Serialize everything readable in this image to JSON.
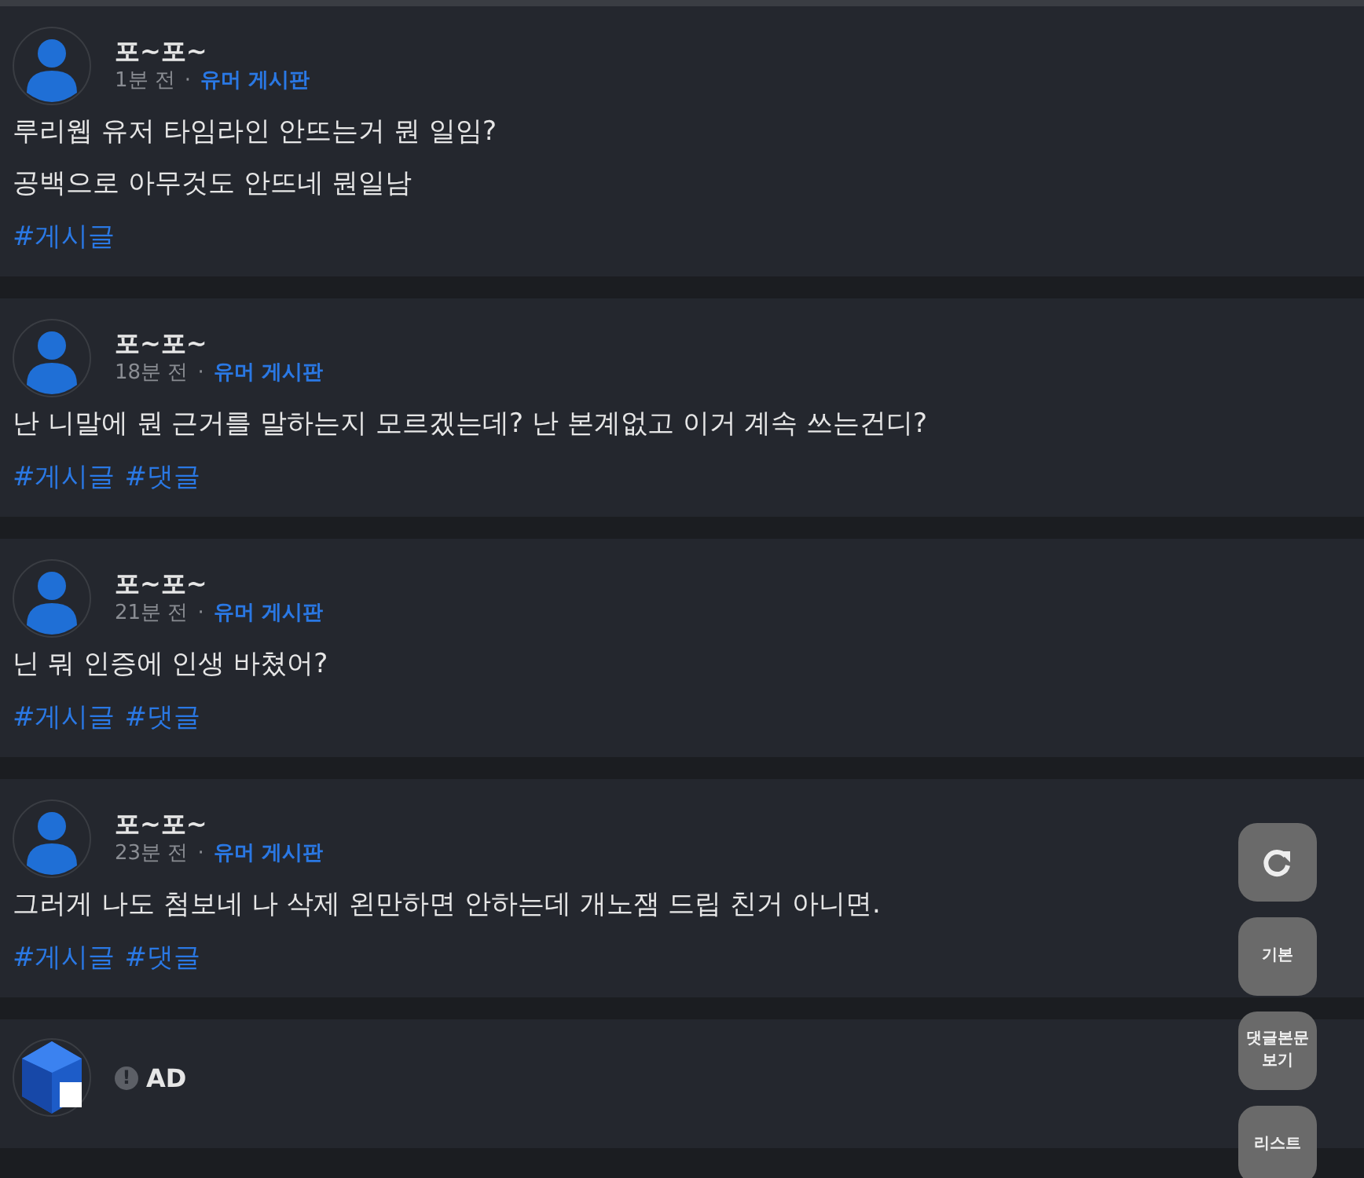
{
  "posts": [
    {
      "author": "포~포~",
      "time": "1분 전",
      "separator": "·",
      "board": "유머 게시판",
      "lines": [
        "루리웹 유저 타임라인 안뜨는거 뭔 일임?",
        "공백으로 아무것도 안뜨네 뭔일남"
      ],
      "tags": [
        "#게시글"
      ]
    },
    {
      "author": "포~포~",
      "time": "18분 전",
      "separator": "·",
      "board": "유머 게시판",
      "lines": [
        "난 니말에 뭔 근거를 말하는지 모르겠는데? 난 본계없고 이거 계속 쓰는건디?"
      ],
      "tags": [
        "#게시글",
        "#댓글"
      ]
    },
    {
      "author": "포~포~",
      "time": "21분 전",
      "separator": "·",
      "board": "유머 게시판",
      "lines": [
        "닌 뭐 인증에 인생 바쳤어?"
      ],
      "tags": [
        "#게시글",
        "#댓글"
      ]
    },
    {
      "author": "포~포~",
      "time": "23분 전",
      "separator": "·",
      "board": "유머 게시판",
      "lines": [
        "그러게 나도 첨보네 나 삭제 왼만하면 안하는데 개노잼 드립 친거 아니면."
      ],
      "tags": [
        "#게시글",
        "#댓글"
      ]
    }
  ],
  "ad": {
    "label": "AD",
    "alert": "!"
  },
  "float_buttons": [
    {
      "kind": "icon"
    },
    {
      "kind": "text",
      "label": "기본"
    },
    {
      "kind": "text",
      "label": "댓글본문\n보기"
    },
    {
      "kind": "text",
      "label": "리스트"
    }
  ]
}
